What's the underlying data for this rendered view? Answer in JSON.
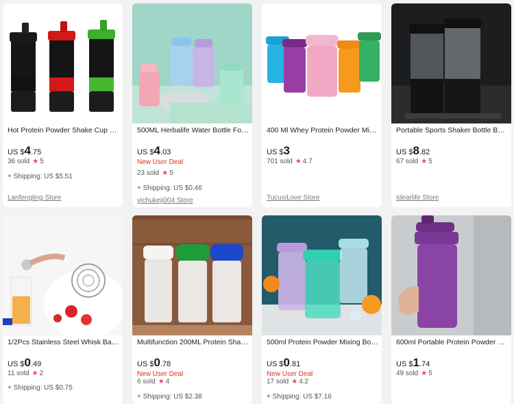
{
  "products": [
    {
      "title": "Hot Protein Powder Shake Cup 3 L...",
      "currency": "US $",
      "price_int": "4",
      "price_dec": ".75",
      "deal": "",
      "sold": "36 sold",
      "rating": "5",
      "shipping": "+ Shipping: US $5.51",
      "store": "Lanfengling Store"
    },
    {
      "title": "500ML Herbalife Water Bottle For ...",
      "currency": "US $",
      "price_int": "4",
      "price_dec": ".03",
      "deal": "New User Deal",
      "sold": "23 sold",
      "rating": "5",
      "shipping": "+ Shipping: US $0.46",
      "store": "yichukeji004 Store"
    },
    {
      "title": "400 Ml Whey Protein Powder Mixi...",
      "currency": "US $",
      "price_int": "3",
      "price_dec": "",
      "deal": "",
      "sold": "701 sold",
      "rating": "4.7",
      "shipping": "",
      "store": "TucuxiLove Store"
    },
    {
      "title": "Portable Sports Shaker Bottle BPA ...",
      "currency": "US $",
      "price_int": "8",
      "price_dec": ".82",
      "deal": "",
      "sold": "67 sold",
      "rating": "5",
      "shipping": "",
      "store": "Idearlife Store"
    },
    {
      "title": "1/2Pcs Stainless Steel Whisk Ball M...",
      "currency": "US $",
      "price_int": "0",
      "price_dec": ".49",
      "deal": "",
      "sold": "11 sold",
      "rating": "2",
      "shipping": "+ Shipping: US $0.75",
      "store": ""
    },
    {
      "title": "Multifunction 200ML Protein Shak...",
      "currency": "US $",
      "price_int": "0",
      "price_dec": ".78",
      "deal": "New User Deal",
      "sold": "6 sold",
      "rating": "4",
      "shipping": "+ Shipping: US $2.38",
      "store": ""
    },
    {
      "title": "500ml Protein Powder Mixing Bottl...",
      "currency": "US $",
      "price_int": "0",
      "price_dec": ".81",
      "deal": "New User Deal",
      "sold": "17 sold",
      "rating": "4.2",
      "shipping": "+ Shipping: US $7.16",
      "store": ""
    },
    {
      "title": "600ml Portable Protein Powder Sh...",
      "currency": "US $",
      "price_int": "1",
      "price_dec": ".74",
      "deal": "",
      "sold": "49 sold",
      "rating": "5",
      "shipping": "",
      "store": ""
    }
  ],
  "rating_icon": "star-icon",
  "colors": {
    "deal": "#e0311e",
    "star": "#ee4266",
    "background": "#f2f2f2"
  }
}
